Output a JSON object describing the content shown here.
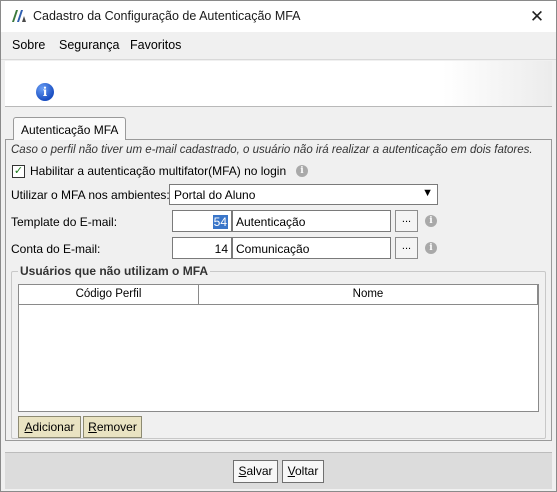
{
  "window": {
    "title": "Cadastro da Configuração de Autenticação MFA",
    "close_glyph": "✕"
  },
  "menubar": {
    "items": [
      "Sobre",
      "Segurança",
      "Favoritos"
    ]
  },
  "banner": {
    "icon": "info-icon",
    "glyph": "i"
  },
  "tab": {
    "label": "Autenticação MFA"
  },
  "form": {
    "note": "Caso o perfil não tiver um e-mail cadastrado, o usuário não irá realizar a autenticação em dois fatores.",
    "mfa_checkbox": {
      "label": "Habilitar a autenticação multifator(MFA) no login",
      "checked": true,
      "check_glyph": "✓"
    },
    "ambientes": {
      "label": "Utilizar o MFA nos ambientes:",
      "value": "Portal do Aluno",
      "arrow": "▼"
    },
    "template": {
      "label": "Template do E-mail:",
      "code": "54",
      "name": "Autenticação",
      "lookup": "..."
    },
    "conta": {
      "label": "Conta do E-mail:",
      "code": "14",
      "name": "Comunicação",
      "lookup": "..."
    },
    "info_glyph": "i"
  },
  "group": {
    "title": "Usuários que não utilizam o MFA",
    "columns": [
      "Código Perfil",
      "Nome"
    ],
    "rows": [],
    "add_button": {
      "underline": "A",
      "rest": "dicionar"
    },
    "remove_button": {
      "underline": "R",
      "rest": "emover"
    }
  },
  "footer": {
    "save_button": {
      "underline": "S",
      "rest": "alvar"
    },
    "back_button": {
      "underline": "V",
      "rest": "oltar"
    }
  }
}
